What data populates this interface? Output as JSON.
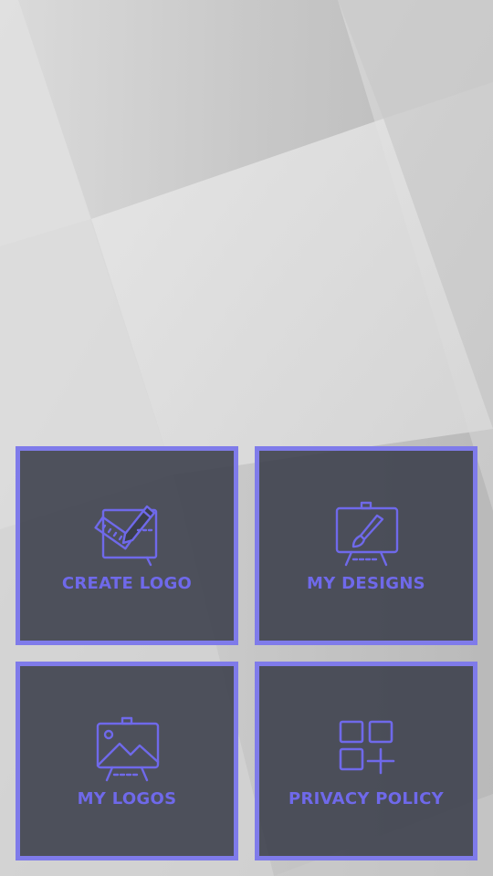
{
  "menu": {
    "create_logo": {
      "label": "CREATE LOGO",
      "icon": "easel-ruler-pencil-icon"
    },
    "my_designs": {
      "label": "MY DESIGNS",
      "icon": "easel-brush-icon"
    },
    "my_logos": {
      "label": "MY LOGOS",
      "icon": "easel-picture-icon"
    },
    "privacy_policy": {
      "label": "PRIVACY POLICY",
      "icon": "grid-plus-icon"
    }
  },
  "colors": {
    "accent": "#7f7bea",
    "label_text": "#6f69ea",
    "tile_background": "#3a3e4a",
    "background_light": "#e6e6e6",
    "background_dark": "#b9b9b9"
  }
}
